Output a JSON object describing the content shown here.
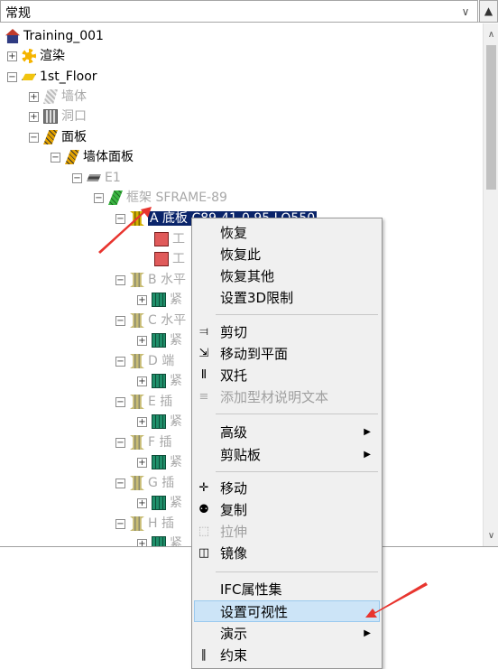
{
  "combo": {
    "value": "常规",
    "dropdown_icon": "chevron-down-icon"
  },
  "collapse_icon": "triangle-up-icon",
  "tree": {
    "root": "Training_001",
    "render": "渲染",
    "floor": "1st_Floor",
    "wall": "墙体",
    "opening": "洞口",
    "panel": "面板",
    "wall_panel": "墙体面板",
    "e1": "E1",
    "frame": "框架 SFRAME-89",
    "a_item": "A 底板 C89-41-0.95 LQ550",
    "sub1": "工",
    "sub2": "工",
    "b": "B 水平",
    "b_child": "紧",
    "c": "C 水平",
    "c_child": "紧",
    "d": "D 端",
    "d_child": "紧",
    "e": "E 插",
    "e_child": "紧",
    "f": "F 插",
    "f_child": "紧",
    "g": "G 插",
    "g_child": "紧",
    "h": "H 插",
    "h_child": "紧"
  },
  "context_menu": {
    "restore": "恢复",
    "restore_this": "恢复此",
    "restore_others": "恢复其他",
    "set_3d_limit": "设置3D限制",
    "cut": "剪切",
    "move_to_plane": "移动到平面",
    "double_stud": "双托",
    "add_profile_text": "添加型材说明文本",
    "advanced": "高级",
    "clipboard": "剪贴板",
    "move": "移动",
    "copy": "复制",
    "stretch": "拉伸",
    "mirror": "镜像",
    "ifc_property_set": "IFC属性集",
    "set_visibility": "设置可视性",
    "demo": "演示",
    "constraint": "约束",
    "submenu_icon": "triangle-right-icon"
  },
  "colors": {
    "selection": "#0a246a",
    "highlight": "#cce4f7",
    "annotation_arrow": "#e8352f"
  }
}
